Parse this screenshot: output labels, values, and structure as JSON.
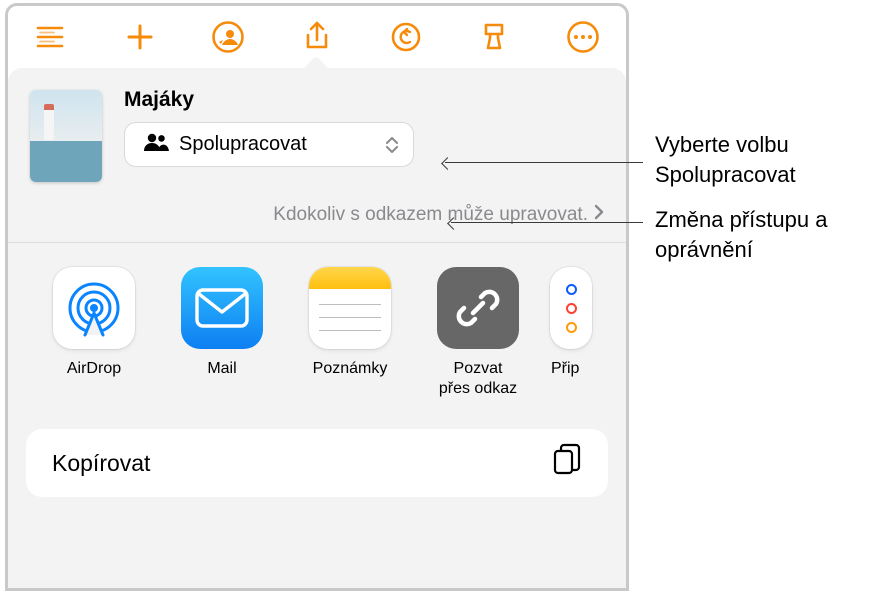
{
  "document": {
    "title": "Majáky"
  },
  "share": {
    "collaborate_label": "Spolupracovat",
    "access_text": "Kdokoliv s odkazem může upravovat."
  },
  "apps": {
    "airdrop": "AirDrop",
    "mail": "Mail",
    "notes": "Poznámky",
    "invite": "Pozvat\npřes odkaz",
    "overflow": "Přip"
  },
  "actions": {
    "copy": "Kopírovat"
  },
  "callouts": {
    "collab": "Vyberte volbu Spolupracovat",
    "access": "Změna přístupu a oprávnění"
  }
}
